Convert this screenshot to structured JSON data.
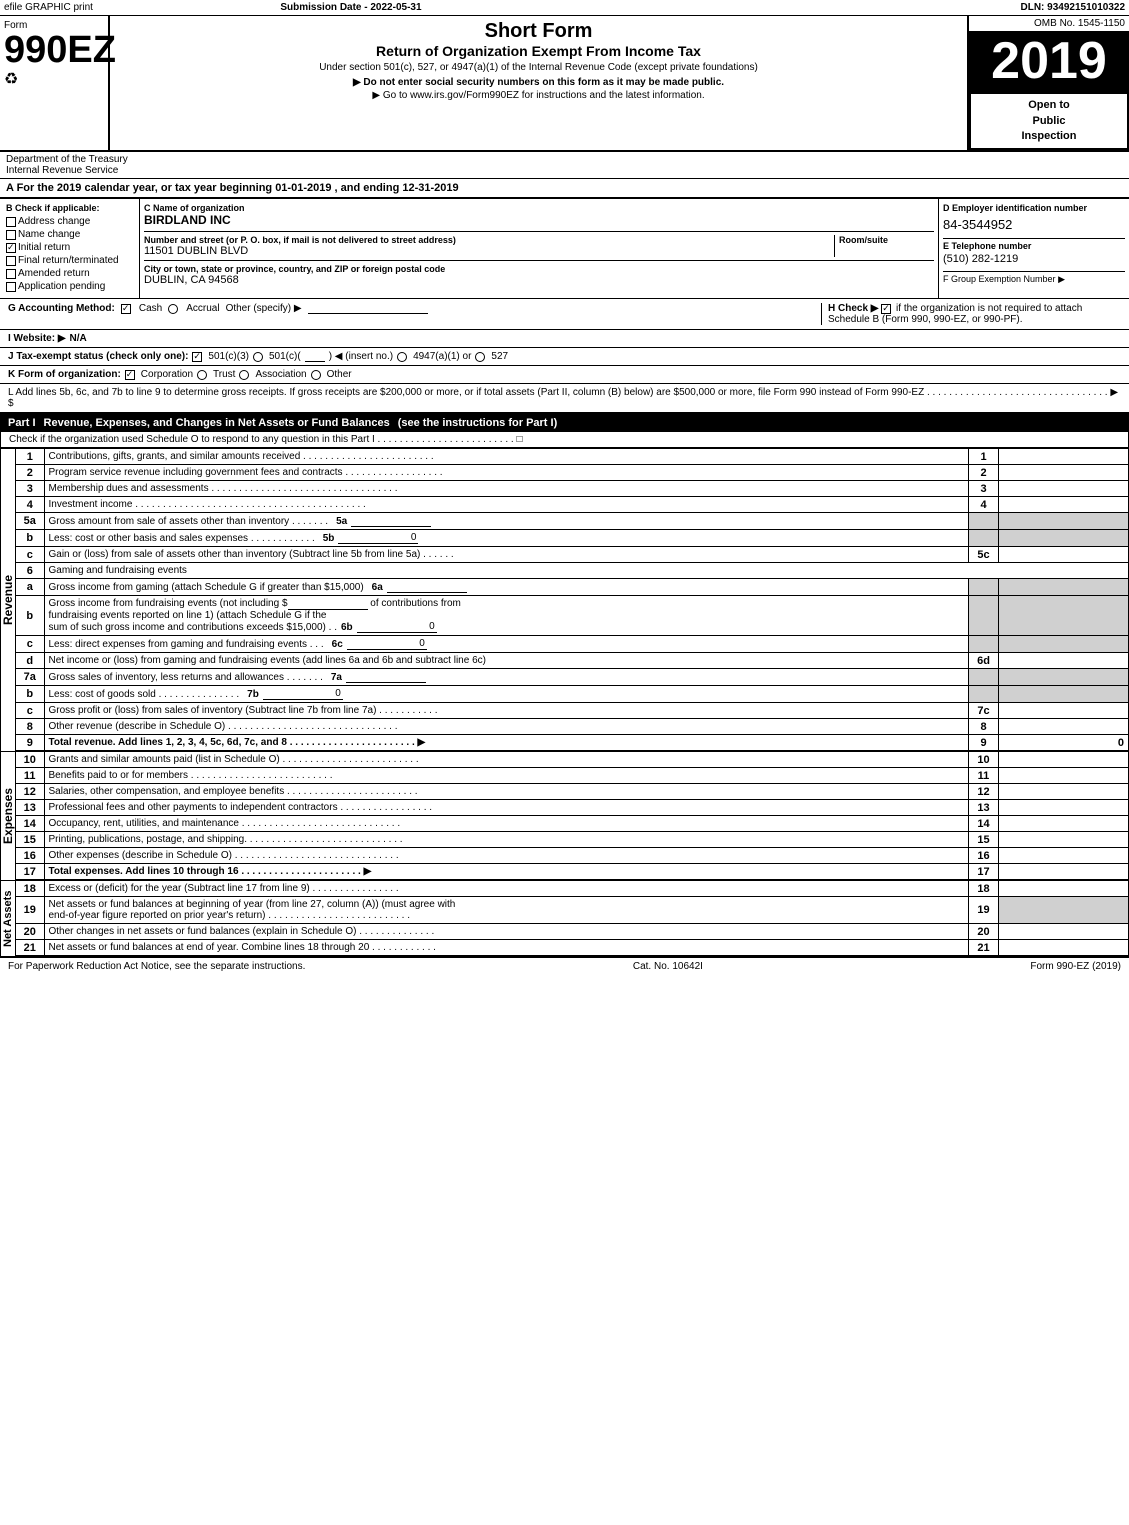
{
  "topBar": {
    "left": "efile GRAPHIC print",
    "middle": "Submission Date - 2022-05-31",
    "right": "DLN: 93492151010322"
  },
  "header": {
    "formLabel": "Form",
    "formNumber": "990EZ",
    "recycleSymbol": "♻",
    "shortFormTitle": "Short Form",
    "mainTitle": "Return of Organization Exempt From Income Tax",
    "subtitle": "Under section 501(c), 527, or 4947(a)(1) of the Internal Revenue Code (except private foundations)",
    "noSSN": "▶ Do not enter social security numbers on this form as it may be made public.",
    "goTo": "▶ Go to www.irs.gov/Form990EZ for instructions and the latest information.",
    "year": "2019",
    "openToPublic": "Open to\nPublic\nInspection",
    "ombNo": "OMB No. 1545-1150"
  },
  "department": {
    "name": "Department of the Treasury",
    "internal": "Internal Revenue Service"
  },
  "taxYear": {
    "text": "A For the 2019 calendar year, or tax year beginning 01-01-2019 , and ending 12-31-2019"
  },
  "checkboxes": {
    "sectionLabel": "B Check if applicable:",
    "items": [
      {
        "label": "Address change",
        "checked": false
      },
      {
        "label": "Name change",
        "checked": false
      },
      {
        "label": "Initial return",
        "checked": true
      },
      {
        "label": "Final return/terminated",
        "checked": false
      },
      {
        "label": "Amended return",
        "checked": false
      },
      {
        "label": "Application pending",
        "checked": false
      }
    ]
  },
  "orgInfo": {
    "cLabel": "C Name of organization",
    "orgName": "BIRDLAND INC",
    "addressLabel": "Number and street (or P. O. box, if mail is not delivered to street address)",
    "address": "11501 DUBLIN BLVD",
    "roomSuiteLabel": "Room/suite",
    "roomSuite": "",
    "cityLabel": "City or town, state or province, country, and ZIP or foreign postal code",
    "city": "DUBLIN, CA  94568"
  },
  "einSection": {
    "dLabel": "D Employer identification number",
    "ein": "84-3544952",
    "eLabel": "E Telephone number",
    "phone": "(510) 282-1219",
    "fLabel": "F Group Exemption Number",
    "fArrow": "▶"
  },
  "accounting": {
    "gLabel": "G Accounting Method:",
    "cashLabel": "Cash",
    "cashChecked": true,
    "accrualLabel": "Accrual",
    "accrualChecked": false,
    "otherLabel": "Other (specify) ▶",
    "hLabel": "H Check ▶",
    "hChecked": true,
    "hText": "if the organization is not required to attach Schedule B (Form 990, 990-EZ, or 990-PF)."
  },
  "website": {
    "iLabel": "I Website: ▶",
    "url": "N/A"
  },
  "taxStatus": {
    "jLabel": "J Tax-exempt status (check only one):",
    "options": [
      {
        "label": "501(c)(3)",
        "checked": true
      },
      {
        "label": "501(c)(  )",
        "checked": false,
        "insertNo": "◀ (insert no.)"
      },
      {
        "label": "4947(a)(1) or",
        "checked": false
      },
      {
        "label": "527",
        "checked": false
      }
    ]
  },
  "formOrg": {
    "kLabel": "K Form of organization:",
    "options": [
      {
        "label": "Corporation",
        "checked": true
      },
      {
        "label": "Trust",
        "checked": false
      },
      {
        "label": "Association",
        "checked": false
      },
      {
        "label": "Other",
        "checked": false
      }
    ]
  },
  "grossReceipts": {
    "lText": "L Add lines 5b, 6c, and 7b to line 9 to determine gross receipts. If gross receipts are $200,000 or more, or if total assets (Part II, column (B) below) are $500,000 or more, file Form 990 instead of Form 990-EZ . . . . . . . . . . . . . . . . . . . . . . . . . . . . . . . . . ▶ $"
  },
  "partI": {
    "label": "Part I",
    "title": "Revenue, Expenses, and Changes in Net Assets or Fund Balances",
    "seeInstructions": "(see the instructions for Part I)",
    "scheduleOCheck": "Check if the organization used Schedule O to respond to any question in this Part I . . . . . . . . . . . . . . . . . . . . . . . . . □",
    "lines": [
      {
        "num": "1",
        "desc": "Contributions, gifts, grants, and similar amounts received . . . . . . . . . . . . . . . . . . . . . . . .",
        "lineNum": "1",
        "value": ""
      },
      {
        "num": "2",
        "desc": "Program service revenue including government fees and contracts . . . . . . . . . . . . . . . . . .",
        "lineNum": "2",
        "value": ""
      },
      {
        "num": "3",
        "desc": "Membership dues and assessments . . . . . . . . . . . . . . . . . . . . . . . . . . . . . . . . . .",
        "lineNum": "3",
        "value": ""
      },
      {
        "num": "4",
        "desc": "Investment income . . . . . . . . . . . . . . . . . . . . . . . . . . . . . . . . . . . . . . . . . .",
        "lineNum": "4",
        "value": ""
      },
      {
        "num": "5a",
        "desc": "Gross amount from sale of assets other than inventory . . . . . . .",
        "subNum": "5a",
        "subValue": "",
        "lineNum": "",
        "value": ""
      },
      {
        "num": "5b",
        "desc": "Less: cost or other basis and sales expenses . . . . . . . . . . . .",
        "subNum": "5b",
        "subValue": "0",
        "lineNum": "",
        "value": ""
      },
      {
        "num": "5c",
        "desc": "Gain or (loss) from sale of assets other than inventory (Subtract line 5b from line 5a) . . . . . .",
        "lineNum": "5c",
        "value": ""
      },
      {
        "num": "6",
        "desc": "Gaming and fundraising events",
        "lineNum": "",
        "value": "",
        "header": true
      },
      {
        "num": "6a",
        "desc": "Gross income from gaming (attach Schedule G if greater than $15,000)",
        "subNum": "6a",
        "subValue": "",
        "lineNum": "",
        "value": ""
      },
      {
        "num": "6b",
        "desc": "Gross income from fundraising events (not including $_______ of contributions from fundraising events reported on line 1) (attach Schedule G if the sum of such gross income and contributions exceeds $15,000)   .   .",
        "subNum": "6b",
        "subValue": "0",
        "lineNum": "",
        "value": ""
      },
      {
        "num": "6c",
        "desc": "Less: direct expenses from gaming and fundraising events   .   .   .",
        "subNum": "6c",
        "subValue": "0",
        "lineNum": "",
        "value": ""
      },
      {
        "num": "6d",
        "desc": "Net income or (loss) from gaming and fundraising events (add lines 6a and 6b and subtract line 6c)",
        "lineNum": "6d",
        "value": ""
      },
      {
        "num": "7a",
        "desc": "Gross sales of inventory, less returns and allowances . . . . . . .",
        "subNum": "7a",
        "subValue": "",
        "lineNum": "",
        "value": ""
      },
      {
        "num": "7b",
        "desc": "Less: cost of goods sold   .   .   .   .   .   .   .   .   .   .   .   .   .   .   .",
        "subNum": "7b",
        "subValue": "0",
        "lineNum": "",
        "value": ""
      },
      {
        "num": "7c",
        "desc": "Gross profit or (loss) from sales of inventory (Subtract line 7b from line 7a) . . . . . . . . . . .",
        "lineNum": "7c",
        "value": ""
      },
      {
        "num": "8",
        "desc": "Other revenue (describe in Schedule O) . . . . . . . . . . . . . . . . . . . . . . . . . . . . . . .",
        "lineNum": "8",
        "value": ""
      },
      {
        "num": "9",
        "desc": "Total revenue. Add lines 1, 2, 3, 4, 5c, 6d, 7c, and 8 . . . . . . . . . . . . . . . . . . . . . . . ▶",
        "lineNum": "9",
        "value": "0",
        "bold": true
      }
    ]
  },
  "expenses": {
    "lines": [
      {
        "num": "10",
        "desc": "Grants and similar amounts paid (list in Schedule O) . . . . . . . . . . . . . . . . . . . . . . . . .",
        "lineNum": "10",
        "value": ""
      },
      {
        "num": "11",
        "desc": "Benefits paid to or for members   .   .   .   .   .   .   .   .   .   .   .   .   .   .   .   .   .   .   .   .   .   .   .   .   .   .",
        "lineNum": "11",
        "value": ""
      },
      {
        "num": "12",
        "desc": "Salaries, other compensation, and employee benefits . . . . . . . . . . . . . . . . . . . . . . . .",
        "lineNum": "12",
        "value": ""
      },
      {
        "num": "13",
        "desc": "Professional fees and other payments to independent contractors . . . . . . . . . . . . . . . . .",
        "lineNum": "13",
        "value": ""
      },
      {
        "num": "14",
        "desc": "Occupancy, rent, utilities, and maintenance . . . . . . . . . . . . . . . . . . . . . . . . . . . . .",
        "lineNum": "14",
        "value": ""
      },
      {
        "num": "15",
        "desc": "Printing, publications, postage, and shipping. . . . . . . . . . . . . . . . . . . . . . . . . . . . .",
        "lineNum": "15",
        "value": ""
      },
      {
        "num": "16",
        "desc": "Other expenses (describe in Schedule O) . . . . . . . . . . . . . . . . . . . . . . . . . . . . . .",
        "lineNum": "16",
        "value": ""
      },
      {
        "num": "17",
        "desc": "Total expenses. Add lines 10 through 16   .   .   .   .   .   .   .   .   .   .   .   .   .   .   .   .   .   .   .   .   .   . ▶",
        "lineNum": "17",
        "value": "",
        "bold": true
      }
    ]
  },
  "netAssets": {
    "lines": [
      {
        "num": "18",
        "desc": "Excess or (deficit) for the year (Subtract line 17 from line 9)   .   .   .   .   .   .   .   .   .   .   .   .   .   .   .   .",
        "lineNum": "18",
        "value": ""
      },
      {
        "num": "19",
        "desc": "Net assets or fund balances at beginning of year (from line 27, column (A)) (must agree with end-of-year figure reported on prior year's return) . . . . . . . . . . . . . . . . . . . . . . . . . .",
        "lineNum": "19",
        "value": ""
      },
      {
        "num": "20",
        "desc": "Other changes in net assets or fund balances (explain in Schedule O) . . . . . . . . . . . . . .",
        "lineNum": "20",
        "value": ""
      },
      {
        "num": "21",
        "desc": "Net assets or fund balances at end of year. Combine lines 18 through 20 . . . . . . . . . . . .",
        "lineNum": "21",
        "value": ""
      }
    ]
  },
  "footer": {
    "paperworkText": "For Paperwork Reduction Act Notice, see the separate instructions.",
    "catNo": "Cat. No. 10642I",
    "formRef": "Form 990-EZ (2019)"
  }
}
